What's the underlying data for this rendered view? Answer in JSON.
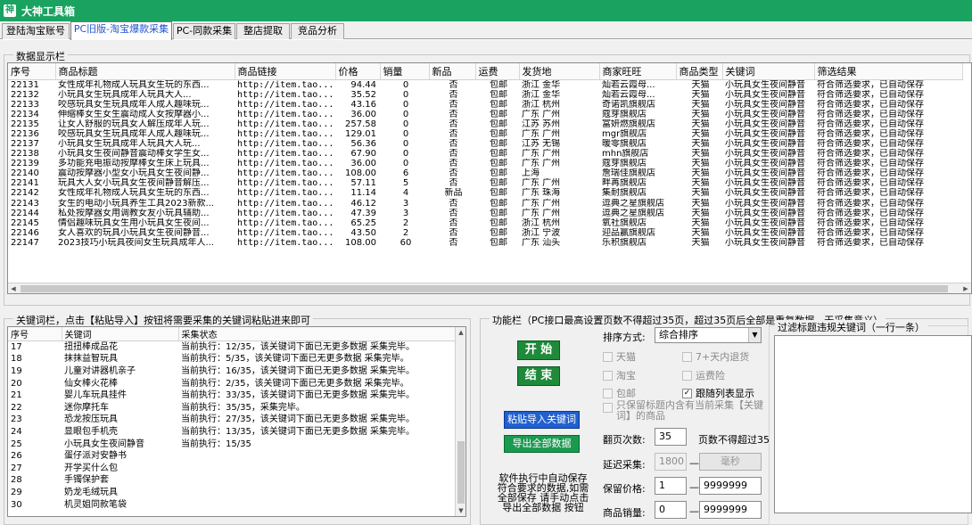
{
  "app": {
    "title": "大神工具箱"
  },
  "tabs": [
    {
      "label": "登陆淘宝账号"
    },
    {
      "label": "PC旧版-淘宝爆款采集"
    },
    {
      "label": "PC-同款采集"
    },
    {
      "label": "整店提取"
    },
    {
      "label": "竞品分析"
    }
  ],
  "data_panel": {
    "title": "数据显示栏",
    "columns": [
      "序号",
      "商品标题",
      "商品链接",
      "价格",
      "销量",
      "新品",
      "运费",
      "发货地",
      "商家旺旺",
      "商品类型",
      "关键词",
      "筛选结果"
    ],
    "rows": [
      [
        "22131",
        "女性成年礼物成人玩具女生玩的东西...",
        "http://item.tao...",
        "94.44",
        "0",
        "否",
        "包邮",
        "浙江 金华",
        "灿若云霞母...",
        "天猫",
        "小玩具女生夜间静音",
        "符合筛选要求，已自动保存"
      ],
      [
        "22132",
        "小玩具女生玩具成年人玩具大人...",
        "http://item.tao...",
        "35.52",
        "0",
        "否",
        "包邮",
        "浙江 金华",
        "灿若云霞母...",
        "天猫",
        "小玩具女生夜间静音",
        "符合筛选要求，已自动保存"
      ],
      [
        "22133",
        "咬感玩具女生玩具成年人成人趣味玩...",
        "http://item.tao...",
        "43.16",
        "0",
        "否",
        "包邮",
        "浙江 杭州",
        "奇诺凯旗舰店",
        "天猫",
        "小玩具女生夜间静音",
        "符合筛选要求，已自动保存"
      ],
      [
        "22134",
        "伸缩棒女生女生震动成人女按摩器小...",
        "http://item.tao...",
        "36.00",
        "0",
        "否",
        "包邮",
        "广东 广州",
        "蔻芽旗舰店",
        "天猫",
        "小玩具女生夜间静音",
        "符合筛选要求，已自动保存"
      ],
      [
        "22135",
        "让女人舒服的玩具女人解压成年人玩...",
        "http://item.tao...",
        "257.58",
        "0",
        "否",
        "包邮",
        "江苏 苏州",
        "富妍燃旗舰店",
        "天猫",
        "小玩具女生夜间静音",
        "符合筛选要求，已自动保存"
      ],
      [
        "22136",
        "咬感玩具女生玩具成年人成人趣味玩...",
        "http://item.tao...",
        "129.01",
        "0",
        "否",
        "包邮",
        "广东 广州",
        "mgr旗舰店",
        "天猫",
        "小玩具女生夜间静音",
        "符合筛选要求，已自动保存"
      ],
      [
        "22137",
        "小玩具女生玩具成年人玩具大人玩...",
        "http://item.tao...",
        "56.36",
        "0",
        "否",
        "包邮",
        "江苏 无锡",
        "暖零旗舰店",
        "天猫",
        "小玩具女生夜间静音",
        "符合筛选要求，已自动保存"
      ],
      [
        "22138",
        "小玩具女生夜间静音震动棒女学生女...",
        "http://item.tao...",
        "67.90",
        "0",
        "否",
        "包邮",
        "广东 广州",
        "mhn旗舰店",
        "天猫",
        "小玩具女生夜间静音",
        "符合筛选要求，已自动保存"
      ],
      [
        "22139",
        "多功能充电振动按摩棒女生床上玩具...",
        "http://item.tao...",
        "36.00",
        "0",
        "否",
        "包邮",
        "广东 广州",
        "蔻芽旗舰店",
        "天猫",
        "小玩具女生夜间静音",
        "符合筛选要求，已自动保存"
      ],
      [
        "22140",
        "震动按摩器小型女小玩具女生夜间静...",
        "http://item.tao...",
        "108.00",
        "6",
        "否",
        "包邮",
        "上海",
        "詹瑞佳旗舰店",
        "天猫",
        "小玩具女生夜间静音",
        "符合筛选要求，已自动保存"
      ],
      [
        "22141",
        "玩具大人女小玩具女生夜间静音解压...",
        "http://item.tao...",
        "57.11",
        "5",
        "否",
        "包邮",
        "广东 广州",
        "畔苒旗舰店",
        "天猫",
        "小玩具女生夜间静音",
        "符合筛选要求，已自动保存"
      ],
      [
        "22142",
        "女性成年礼物成人玩具女生玩的东西...",
        "http://item.tao...",
        "11.14",
        "4",
        "新品",
        "包邮",
        "广东 珠海",
        "集耐旗舰店",
        "天猫",
        "小玩具女生夜间静音",
        "符合筛选要求，已自动保存"
      ],
      [
        "22143",
        "女生的电动小玩具养生工具2023新款...",
        "http://item.tao...",
        "46.12",
        "3",
        "否",
        "包邮",
        "广东 广州",
        "逗典之星旗舰店",
        "天猫",
        "小玩具女生夜间静音",
        "符合筛选要求，已自动保存"
      ],
      [
        "22144",
        "私处按摩器女用调教女友小玩具辅助...",
        "http://item.tao...",
        "47.39",
        "3",
        "否",
        "包邮",
        "广东 广州",
        "逗典之星旗舰店",
        "天猫",
        "小玩具女生夜间静音",
        "符合筛选要求，已自动保存"
      ],
      [
        "22145",
        "情侣趣味玩具女生用小玩具女生夜间...",
        "http://item.tao...",
        "65.25",
        "2",
        "否",
        "包邮",
        "浙江 杭州",
        "氧社旗舰店",
        "天猫",
        "小玩具女生夜间静音",
        "符合筛选要求，已自动保存"
      ],
      [
        "22146",
        "女人喜欢的玩具小玩具女生夜间静音...",
        "http://item.tao...",
        "43.50",
        "2",
        "否",
        "包邮",
        "浙江 宁波",
        "迎品赢旗舰店",
        "天猫",
        "小玩具女生夜间静音",
        "符合筛选要求，已自动保存"
      ],
      [
        "22147",
        "2023技巧小玩具夜间女生玩具成年人...",
        "http://item.tao...",
        "108.00",
        "60",
        "否",
        "包邮",
        "广东 汕头",
        "乐积旗舰店",
        "天猫",
        "小玩具女生夜间静音",
        "符合筛选要求，已自动保存"
      ]
    ]
  },
  "keyword_panel": {
    "title": "关键词栏，点击【粘贴导入】按钮将需要采集的关键词粘贴进来即可",
    "columns": [
      "序号",
      "关键词",
      "采集状态"
    ],
    "rows": [
      [
        "17",
        "扭扭棒成品花",
        "当前执行：12/35，该关键词下面已无更多数据 采集完毕。"
      ],
      [
        "18",
        "抹抹益智玩具",
        "当前执行：5/35，该关键词下面已无更多数据 采集完毕。"
      ],
      [
        "19",
        "儿童对讲器机亲子",
        "当前执行：16/35，该关键词下面已无更多数据 采集完毕。"
      ],
      [
        "20",
        "仙女棒火花棒",
        "当前执行：2/35，该关键词下面已无更多数据 采集完毕。"
      ],
      [
        "21",
        "婴儿车玩具挂件",
        "当前执行：33/35，该关键词下面已无更多数据 采集完毕。"
      ],
      [
        "22",
        "迷你摩托车",
        "当前执行：35/35，采集完毕。"
      ],
      [
        "23",
        "恐龙按压玩具",
        "当前执行：27/35，该关键词下面已无更多数据 采集完毕。"
      ],
      [
        "24",
        "显眼包手机壳",
        "当前执行：13/35，该关键词下面已无更多数据 采集完毕。"
      ],
      [
        "25",
        "小玩具女生夜间静音",
        "当前执行：15/35"
      ],
      [
        "26",
        "蛋仔派对安静书",
        ""
      ],
      [
        "27",
        "开学买什么包",
        ""
      ],
      [
        "28",
        "手镯保护套",
        ""
      ],
      [
        "29",
        "奶龙毛绒玩具",
        ""
      ],
      [
        "30",
        "机灵姐同款笔袋",
        ""
      ]
    ]
  },
  "function_panel": {
    "title": "功能栏（PC接口最高设置页数不得超过35页，超过35页后全部是重复数据，无采集意义）",
    "start_label": "开 始",
    "end_label": "结 束",
    "paste_label": "粘贴导入关键词",
    "export_label": "导出全部数据",
    "note_lines": [
      "软件执行中自动保存",
      "符合要求的数据,如需",
      "全部保存 请手动点击",
      "导出全部数据 按钮"
    ],
    "sort_label": "排序方式:",
    "sort_value": "综合排序",
    "checkboxes": [
      {
        "label": "天猫",
        "checked": "",
        "disabled": true
      },
      {
        "label": "7+天内退货",
        "checked": "",
        "disabled": true
      },
      {
        "label": "淘宝",
        "checked": "",
        "disabled": true
      },
      {
        "label": "运费险",
        "checked": "",
        "disabled": true
      },
      {
        "label": "包邮",
        "checked": "",
        "disabled": true
      },
      {
        "label": "跟随列表显示",
        "checked": "✓",
        "disabled": false
      },
      {
        "label": "只保留标题内含有当前采集【关键词】的商品",
        "checked": "",
        "disabled": true
      }
    ],
    "pages_label": "翻页次数:",
    "pages_value": "35",
    "pages_hint": "页数不得超过35",
    "delay_label": "延迟采集:",
    "delay_value": "1800",
    "delay_dash": "—",
    "delay_unit": "毫秒",
    "price_label": "保留价格:",
    "price_min": "1",
    "price_dash": "—",
    "price_max": "9999999",
    "sales_label": "商品销量:",
    "sales_min": "0",
    "sales_dash": "—",
    "sales_max": "9999999"
  },
  "filter_panel": {
    "title": "过滤标题违规关键词（一行一条）"
  }
}
